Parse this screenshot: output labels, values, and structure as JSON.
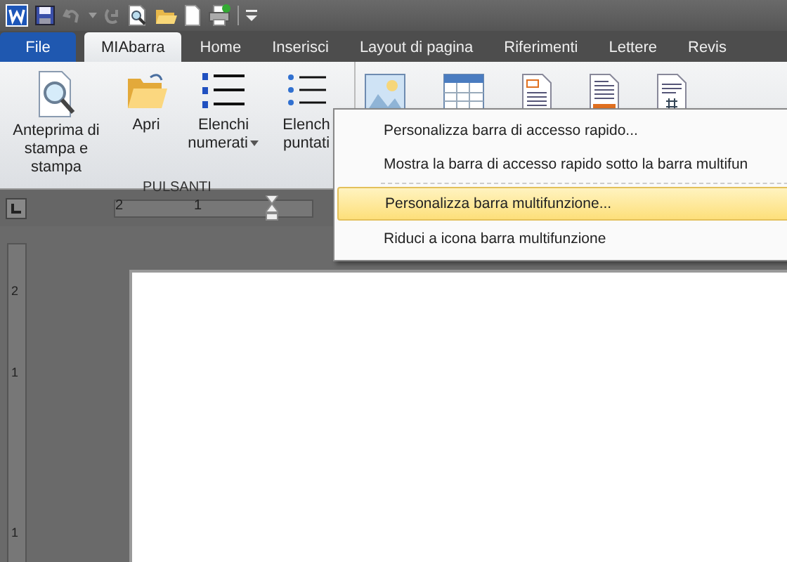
{
  "tabs": [
    {
      "label": "File",
      "kind": "file",
      "selected": false
    },
    {
      "label": "MIAbarra",
      "kind": "tab",
      "selected": true
    },
    {
      "label": "Home",
      "kind": "tab",
      "selected": false
    },
    {
      "label": "Inserisci",
      "kind": "tab",
      "selected": false
    },
    {
      "label": "Layout di pagina",
      "kind": "tab",
      "selected": false
    },
    {
      "label": "Riferimenti",
      "kind": "tab",
      "selected": false
    },
    {
      "label": "Lettere",
      "kind": "tab",
      "selected": false
    },
    {
      "label": "Revis",
      "kind": "tab",
      "selected": false
    }
  ],
  "ribbon": {
    "group_label": "PULSANTI",
    "buttons": [
      {
        "label": "Anteprima di stampa e stampa",
        "kind": "preview",
        "dropdown": false
      },
      {
        "label": "Apri",
        "kind": "folder",
        "dropdown": false
      },
      {
        "label": "Elenchi numerati",
        "kind": "numbered",
        "dropdown": true
      },
      {
        "label": "Elench puntati",
        "kind": "bulleted",
        "dropdown": false
      }
    ]
  },
  "ruler": {
    "labels": [
      "2",
      "1"
    ]
  },
  "vertical_ruler": {
    "labels": [
      "2",
      "1",
      "1"
    ]
  },
  "context_menu": {
    "items": [
      {
        "kind": "item",
        "label": "Personalizza barra di accesso rapido...",
        "selected": false
      },
      {
        "kind": "item",
        "label": "Mostra la barra di accesso rapido sotto la barra multifun",
        "selected": false
      },
      {
        "kind": "separator"
      },
      {
        "kind": "item",
        "label": "Personalizza barra multifunzione...",
        "selected": true
      },
      {
        "kind": "item",
        "label": "Riduci a icona barra multifunzione",
        "selected": false
      }
    ]
  }
}
